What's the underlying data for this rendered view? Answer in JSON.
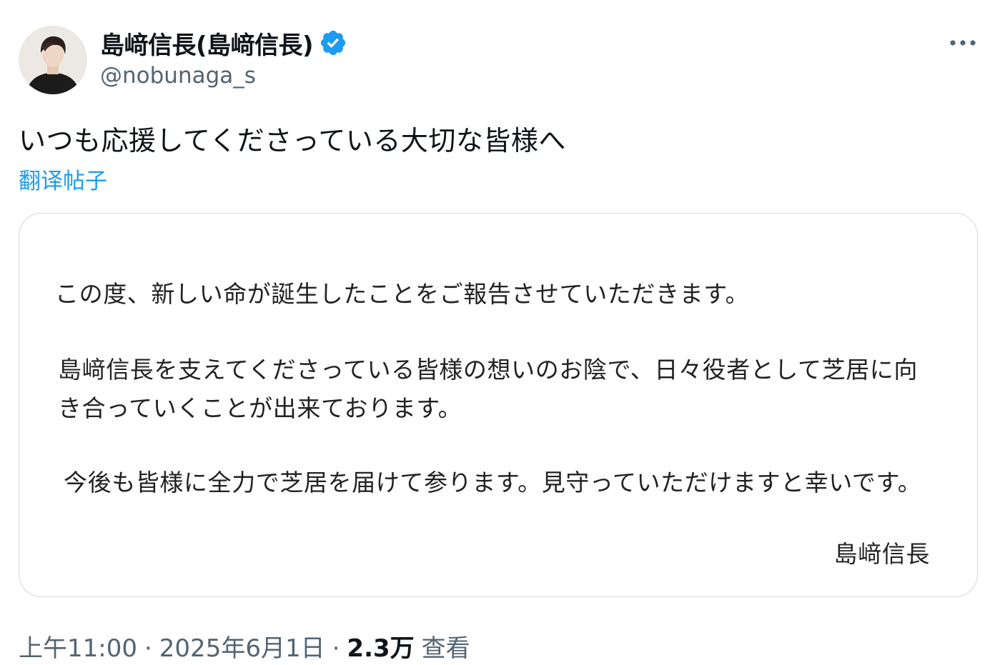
{
  "author": {
    "display_name": "島﨑信長(島﨑信長)",
    "handle": "@nobunaga_s",
    "verified": true,
    "verified_color": "#1d9bf0",
    "avatar_icon": "profile-photo"
  },
  "more_icon": "more-horizontal-icon",
  "tweet": {
    "text": "いつも応援してくださっている大切な皆様へ",
    "translate_label": "翻译帖子"
  },
  "media": {
    "line1": "この度、新しい命が誕生したことをご報告させていただきます。",
    "line2": "島﨑信長を支えてくださっている皆様の想いのお陰で、日々役者として芝居に向",
    "line3": "き合っていくことが出来ております。",
    "line4": "今後も皆様に全力で芝居を届けて参ります。見守っていただけますと幸いです。",
    "signature": "島﨑信長"
  },
  "meta": {
    "time": "上午11:00",
    "separator": "·",
    "date": "2025年6月1日",
    "views_count": "2.3万",
    "views_label": "查看"
  },
  "colors": {
    "link": "#1d9bf0",
    "secondary_text": "#536471",
    "primary_text": "#0f1419",
    "border": "#cfd9de"
  }
}
